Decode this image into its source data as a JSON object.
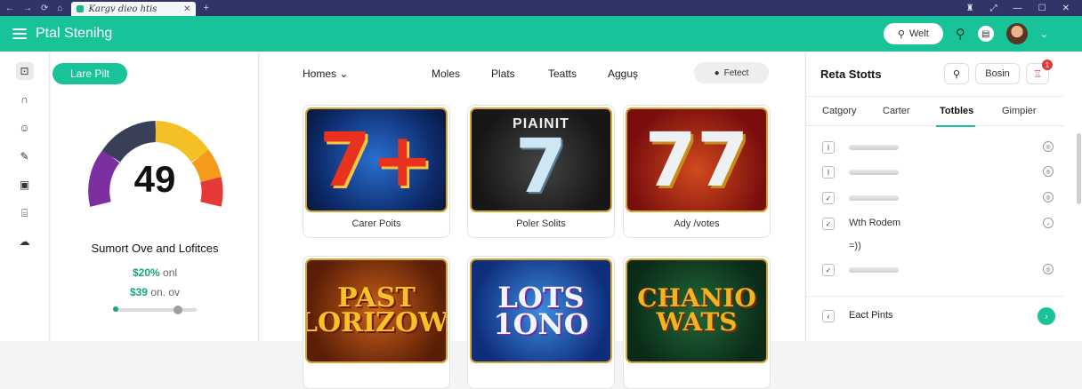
{
  "browser": {
    "tab_title": "Kargv dieo htis",
    "nav_icons": [
      "back-icon",
      "forward-icon",
      "reload-icon",
      "home-icon"
    ],
    "window_icons": [
      "extension-icon",
      "share-icon",
      "minimize-icon",
      "maximize-icon",
      "close-icon"
    ]
  },
  "header": {
    "title": "Ptal Stenihg",
    "wallet_label": "Welt",
    "accent": "#18c39a"
  },
  "rail": {
    "icons": [
      "profile-icon",
      "headset-icon",
      "palette-icon",
      "pen-icon",
      "gamepad-icon",
      "store-icon",
      "cloud-icon"
    ]
  },
  "left_panel": {
    "pill_label": "Lare Pilt",
    "gauge_value": "49",
    "gauge_level": 0.49,
    "summary_title": "Sumort Ove and Lofitces",
    "stat1_value": "$20%",
    "stat1_suffix": "onl",
    "stat2_value": "$39",
    "stat2_suffix": "on. ov",
    "slider_value": 0.77
  },
  "main": {
    "nav": {
      "homes": "Homes",
      "moles": "Moles",
      "plats": "Plats",
      "teatts": "Teatts",
      "aggus": "Agguş"
    },
    "featured_label": "Fetect",
    "cards": [
      {
        "art_text": "7+",
        "caption": "Carer Poits"
      },
      {
        "art_text": "7",
        "art_sub": "PIAINIT",
        "caption": "Poler Solits"
      },
      {
        "art_text": "77",
        "caption": "Ady /votes"
      },
      {
        "art_text": "PAST LLORIZOWN",
        "caption": ""
      },
      {
        "art_text": "LOTS 1ONO",
        "caption": ""
      },
      {
        "art_text": "CHANIO WATS",
        "caption": ""
      }
    ]
  },
  "right_panel": {
    "title": "Reta Stotts",
    "button_label": "Bosin",
    "cart_badge": "1",
    "tabs": [
      "Catgory",
      "Carter",
      "Totbles",
      "Gimpier"
    ],
    "active_tab": "Totbles",
    "row_label": "Wth Rodem",
    "row_note": "=))",
    "footer_label": "Eact Pints"
  }
}
